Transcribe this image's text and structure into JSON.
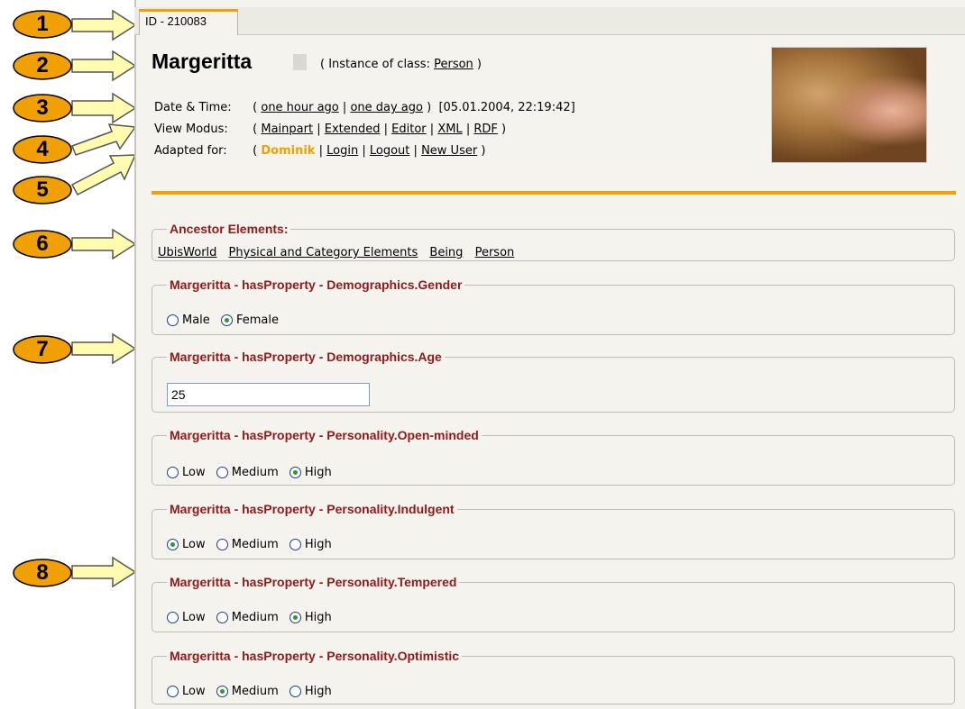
{
  "markers": [
    "1",
    "2",
    "3",
    "4",
    "5",
    "6",
    "7",
    "8"
  ],
  "tab": {
    "label": "ID - 210083"
  },
  "header": {
    "title": "Margeritta",
    "instance_prefix": "( Instance of class:",
    "instance_class": "Person",
    "instance_suffix": ")"
  },
  "datetime": {
    "label": "Date & Time:",
    "open": "(",
    "link1": "one hour ago",
    "sep": "|",
    "link2": "one day ago",
    "close": ")",
    "value": "[05.01.2004, 22:19:42]"
  },
  "view_modus": {
    "label": "View Modus:",
    "open": "(",
    "items": [
      "Mainpart",
      "Extended",
      "Editor",
      "XML",
      "RDF"
    ],
    "sep": "|",
    "close": ")"
  },
  "adapted_for": {
    "label": "Adapted for:",
    "open": "(",
    "user": "Dominik",
    "items": [
      "Login",
      "Logout",
      "New User"
    ],
    "sep": "|",
    "close": ")"
  },
  "ancestors": {
    "legend": "Ancestor Elements:",
    "items": [
      "UbisWorld",
      "Physical and Category Elements",
      "Being",
      "Person"
    ]
  },
  "properties": [
    {
      "legend": "Margeritta - hasProperty - Demographics.Gender",
      "options": [
        "Male",
        "Female"
      ],
      "selected": "Female"
    },
    {
      "legend": "Margeritta - hasProperty - Demographics.Age",
      "value": "25"
    },
    {
      "legend": "Margeritta - hasProperty - Personality.Open-minded",
      "options": [
        "Low",
        "Medium",
        "High"
      ],
      "selected": "High"
    },
    {
      "legend": "Margeritta - hasProperty - Personality.Indulgent",
      "options": [
        "Low",
        "Medium",
        "High"
      ],
      "selected": "Low"
    },
    {
      "legend": "Margeritta - hasProperty - Personality.Tempered",
      "options": [
        "Low",
        "Medium",
        "High"
      ],
      "selected": "High"
    },
    {
      "legend": "Margeritta - hasProperty - Personality.Optimistic",
      "options": [
        "Low",
        "Medium",
        "High"
      ],
      "selected": "Medium"
    }
  ],
  "colors": {
    "accent": "#f0a000",
    "legend": "#8f1a1a",
    "marker_fill": "#f0a000",
    "arrow_fill": "#fffcb0"
  }
}
